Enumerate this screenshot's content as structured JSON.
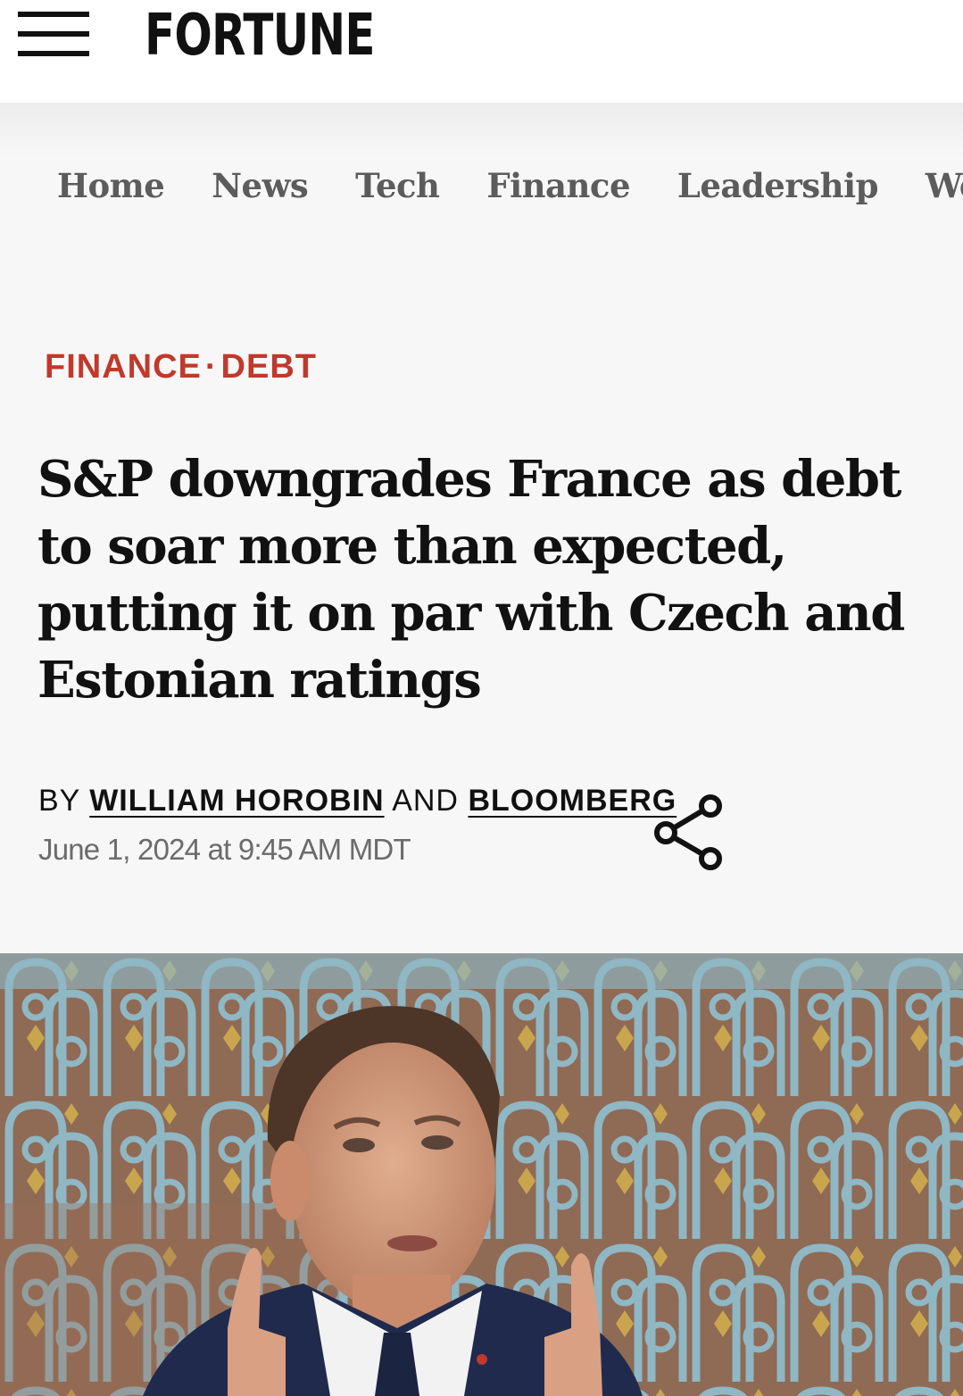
{
  "header": {
    "menu_icon": "hamburger-menu-icon",
    "logo": "FORTUNE"
  },
  "nav": {
    "items": [
      {
        "label": "Home"
      },
      {
        "label": "News"
      },
      {
        "label": "Tech"
      },
      {
        "label": "Finance"
      },
      {
        "label": "Leadership"
      },
      {
        "label": "Well"
      }
    ]
  },
  "article": {
    "category_primary": "FINANCE",
    "category_separator": "·",
    "category_secondary": "DEBT",
    "headline": "S&P downgrades France as debt to soar more than expected, putting it on par with Czech and Estonian ratings",
    "byline_prefix": "BY",
    "author_1": "WILLIAM HOROBIN",
    "byline_and": "AND",
    "author_2": "BLOOMBERG",
    "date": "June 1, 2024 at 9:45 AM MDT",
    "share_icon": "share-icon",
    "image_icon": "hero-photo"
  },
  "colors": {
    "category_accent": "#c0392b",
    "nav_text": "#5c5c5c",
    "date_text": "#6b6b6b"
  }
}
